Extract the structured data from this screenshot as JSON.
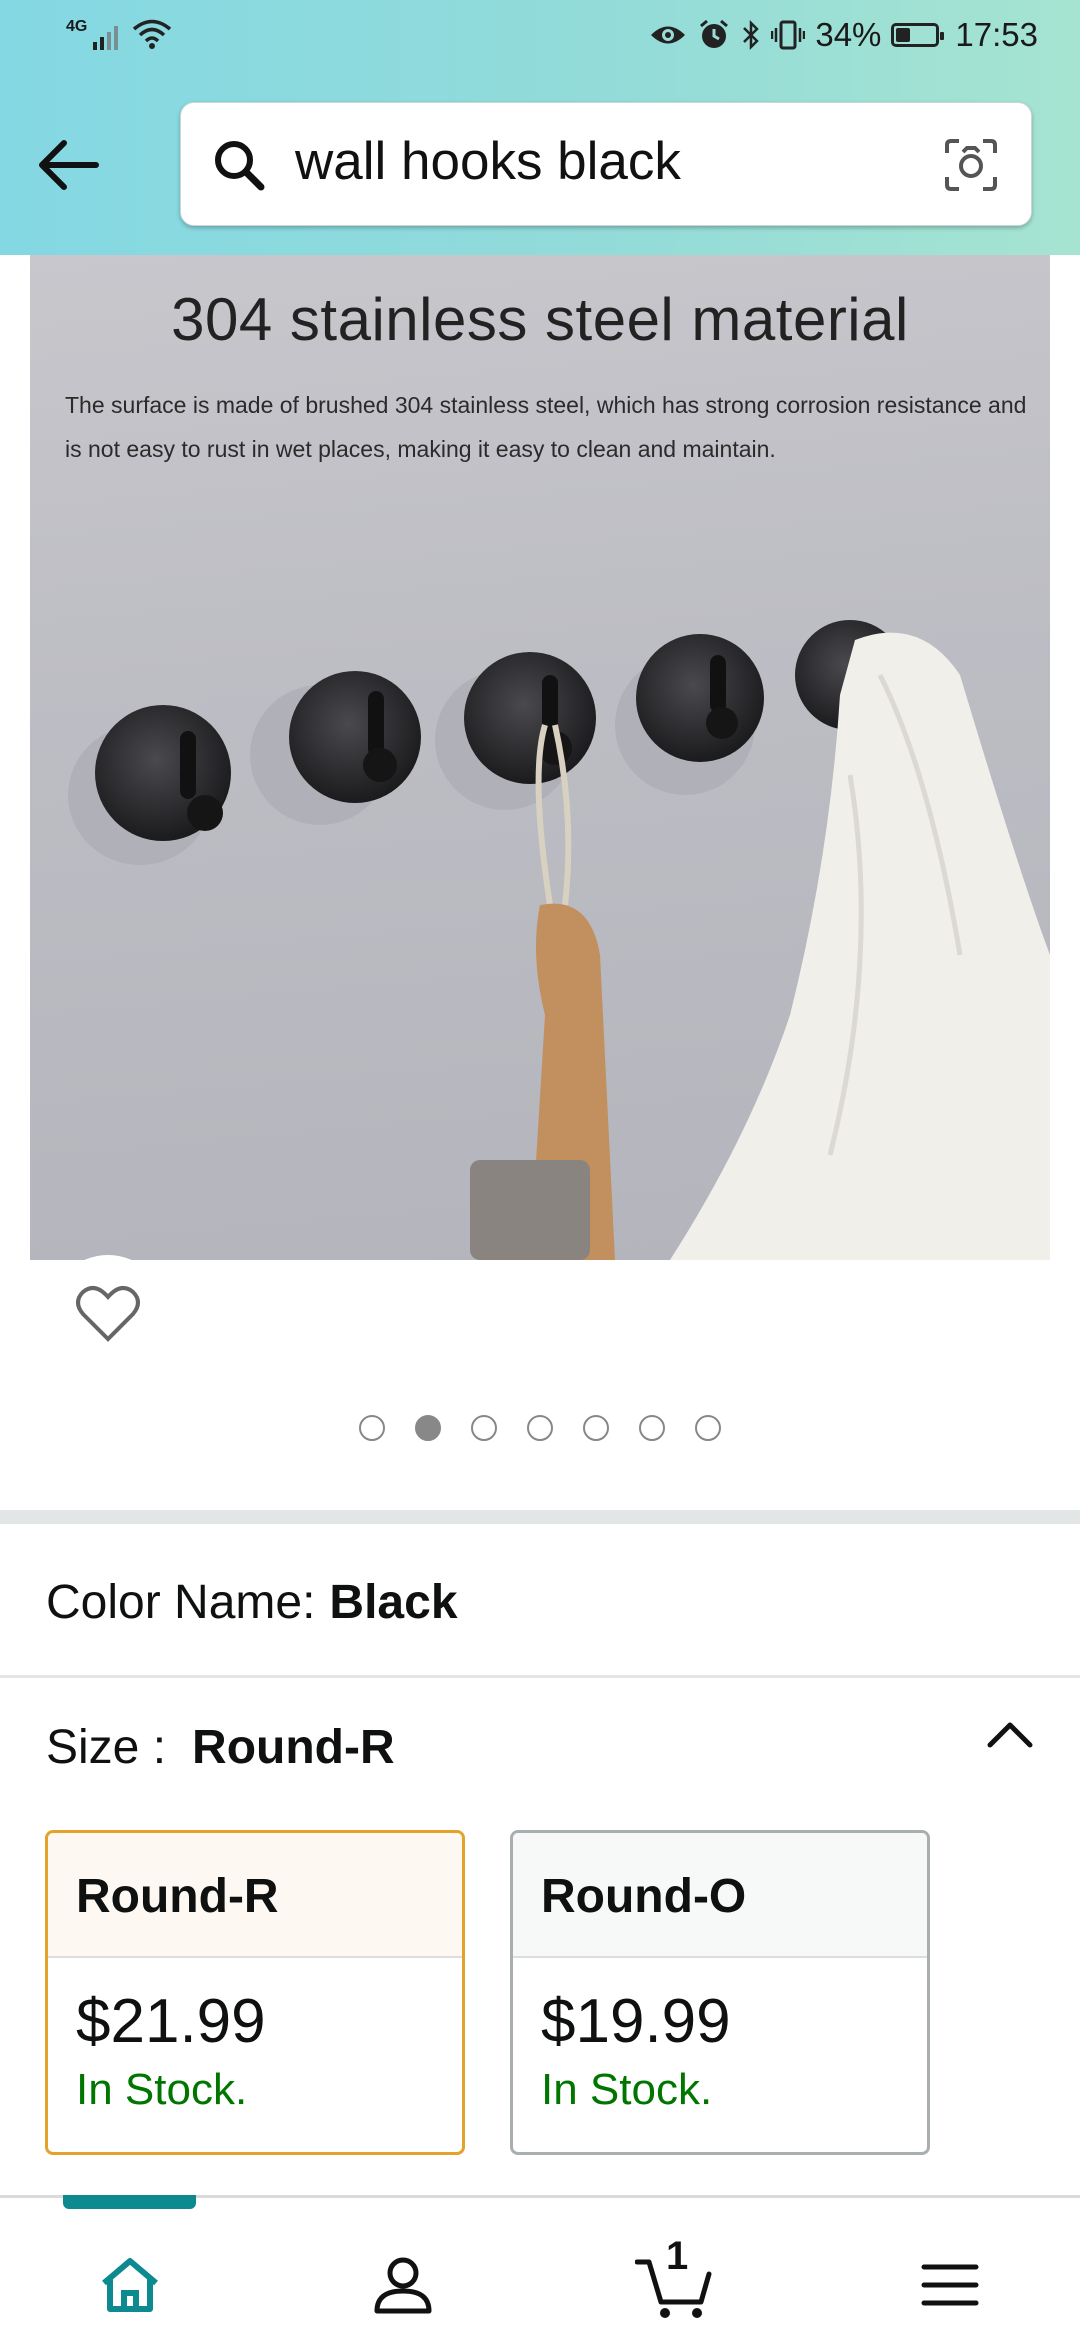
{
  "status_bar": {
    "network": "4G",
    "battery": "34%",
    "time": "17:53",
    "battery_level": 0.34
  },
  "search": {
    "query": "wall hooks black",
    "search_icon": "search-icon",
    "camera_icon": "camera-scan-icon"
  },
  "product_image": {
    "title": "304 stainless steel material",
    "description": "The surface is made of brushed 304 stainless steel, which has strong corrosion resistance and is not easy to rust in wet places, making it easy to clean and maintain."
  },
  "carousel": {
    "total": 7,
    "active_index": 1
  },
  "color": {
    "label": "Color Name:",
    "value": "Black"
  },
  "size": {
    "label": "Size :",
    "value": "Round-R",
    "options": [
      {
        "name": "Round-R",
        "price": "$21.99",
        "stock": "In Stock.",
        "selected": true
      },
      {
        "name": "Round-O",
        "price": "$19.99",
        "stock": "In Stock.",
        "selected": false
      }
    ]
  },
  "bottom_nav": {
    "cart_count": "1",
    "accent": "#0d8a8f"
  },
  "colors": {
    "selected_border": "#e3a32b",
    "in_stock": "#007600"
  }
}
